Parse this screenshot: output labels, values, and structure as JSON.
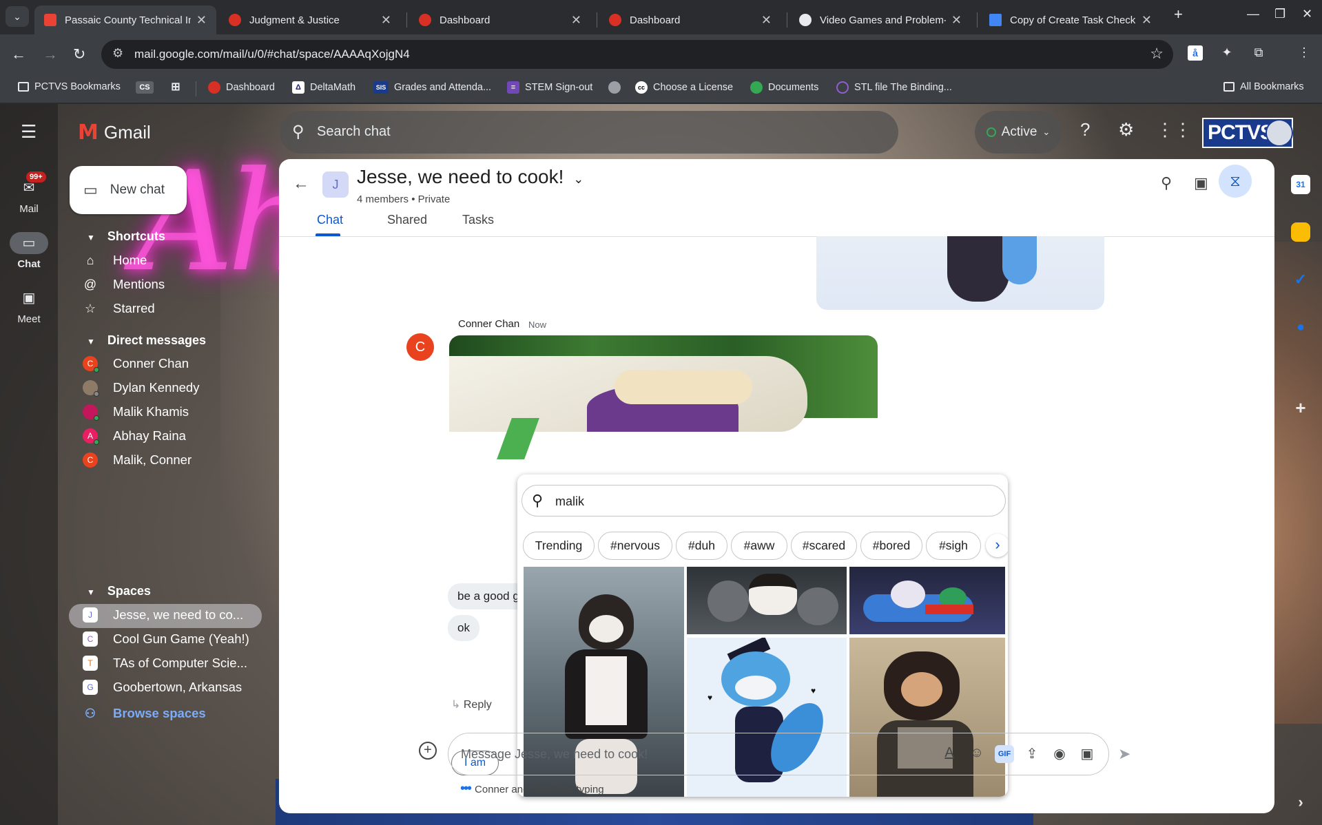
{
  "browser": {
    "tabs": [
      {
        "title": "Passaic County Technical Ins",
        "favicon_color": "#ea4335",
        "active": true
      },
      {
        "title": "Judgment & Justice",
        "favicon_color": "#d93025",
        "active": false
      },
      {
        "title": "Dashboard",
        "favicon_color": "#d93025",
        "active": false
      },
      {
        "title": "Dashboard",
        "favicon_color": "#d93025",
        "active": false
      },
      {
        "title": "Video Games and Problem-S",
        "favicon_color": "#e8eaed",
        "active": false
      },
      {
        "title": "Copy of Create Task Checkli",
        "favicon_color": "#4285f4",
        "active": false
      }
    ],
    "url": "mail.google.com/mail/u/0/#chat/space/AAAAqXojgN4",
    "bookmarks": [
      {
        "label": "PCTVS Bookmarks",
        "icon": "folder-icon"
      },
      {
        "label": "CS",
        "icon": "cs-badge"
      },
      {
        "label": "",
        "icon": "apps-grid-icon"
      },
      {
        "label": "Dashboard",
        "icon": "canvas-icon"
      },
      {
        "label": "DeltaMath",
        "icon": "deltamath-icon"
      },
      {
        "label": "Grades and Attenda...",
        "icon": "sis-icon"
      },
      {
        "label": "STEM Sign-out",
        "icon": "forms-icon"
      },
      {
        "label": "",
        "icon": "globe-icon"
      },
      {
        "label": "Choose a License",
        "icon": "cc-icon"
      },
      {
        "label": "Documents",
        "icon": "documents-icon"
      },
      {
        "label": "STL file The Binding...",
        "icon": "stl-icon"
      }
    ],
    "all_bookmarks": "All Bookmarks"
  },
  "gmail": {
    "wordmark": "Gmail",
    "rail": [
      {
        "label": "Mail",
        "badge": "99+"
      },
      {
        "label": "Chat",
        "badge": ""
      },
      {
        "label": "Meet",
        "badge": ""
      }
    ],
    "search_placeholder": "Search chat",
    "status": "Active",
    "org_logo_text": "PCTVS",
    "new_chat": "New chat",
    "shortcuts_header": "Shortcuts",
    "shortcuts": [
      {
        "label": "Home",
        "icon": "home-icon"
      },
      {
        "label": "Mentions",
        "icon": "at-icon"
      },
      {
        "label": "Starred",
        "icon": "star-icon"
      }
    ],
    "dm_header": "Direct messages",
    "dms": [
      {
        "name": "Conner Chan",
        "initial": "C",
        "color": "#e8431e"
      },
      {
        "name": "Dylan Kennedy",
        "initial": "",
        "color": "#8d7b68"
      },
      {
        "name": "Malik Khamis",
        "initial": "",
        "color": "#c2185b"
      },
      {
        "name": "Abhay Raina",
        "initial": "A",
        "color": "#e91e63"
      },
      {
        "name": "Malik, Conner",
        "initial": "C",
        "color": "#e8431e"
      }
    ],
    "spaces_header": "Spaces",
    "spaces": [
      {
        "name": "Jesse, we need to co...",
        "initial": "J",
        "color": "#5f6bd0"
      },
      {
        "name": "Cool Gun Game (Yeah!)",
        "initial": "C",
        "color": "#8e5fd0"
      },
      {
        "name": "TAs of Computer Scie...",
        "initial": "T",
        "color": "#e8710a"
      },
      {
        "name": "Goobertown, Arkansas",
        "initial": "G",
        "color": "#5f6bd0"
      }
    ],
    "browse_spaces": "Browse spaces"
  },
  "chat": {
    "space_initial": "J",
    "title": "Jesse, we need to cook!",
    "members": "4 members",
    "privacy": "Private",
    "tabs": [
      "Chat",
      "Shared",
      "Tasks"
    ],
    "sender": "Conner Chan",
    "sender_initial": "C",
    "time": "Now",
    "message1": "be a good g",
    "message2": "ok",
    "reply": "Reply",
    "suggestion_chip": "I am",
    "composer_placeholder": "Message Jesse, we need to cook!",
    "typing": "Conner and Malik are typing"
  },
  "gif_picker": {
    "query": "malik",
    "chips": [
      "Trending",
      "#nervous",
      "#duh",
      "#aww",
      "#scared",
      "#bored",
      "#sigh"
    ]
  },
  "colors": {
    "accent_blue": "#0b57d0",
    "gmail_red": "#ea4335",
    "active_green": "#34a853"
  }
}
